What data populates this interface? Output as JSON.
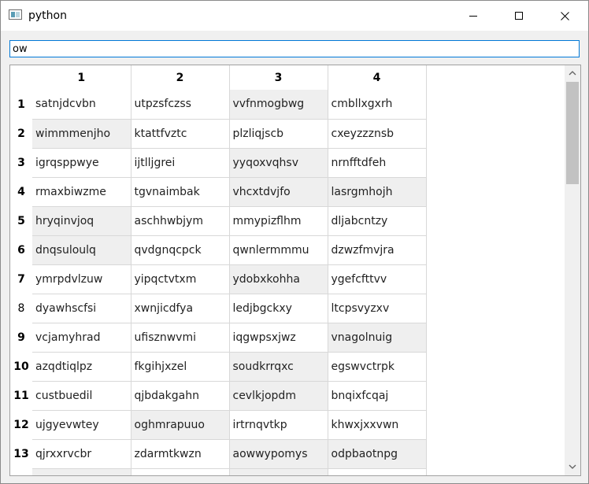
{
  "window": {
    "title": "python"
  },
  "search": {
    "value": "ow"
  },
  "table": {
    "columns": [
      "1",
      "2",
      "3",
      "4"
    ],
    "rows": [
      {
        "label": "1",
        "bold": true,
        "cells": [
          "satnjdcvbn",
          "utpzsfczss",
          "vvfnmogbwg",
          "cmbllxgxrh"
        ],
        "highlight": [
          false,
          false,
          true,
          false
        ]
      },
      {
        "label": "2",
        "bold": true,
        "cells": [
          "wimmmenjho",
          "ktattfvztc",
          "plzliqjscb",
          "cxeyzzznsb"
        ],
        "highlight": [
          true,
          false,
          false,
          false
        ]
      },
      {
        "label": "3",
        "bold": true,
        "cells": [
          "igrqsppwye",
          "ijtlljgrei",
          "yyqoxvqhsv",
          "nrnfftdfeh"
        ],
        "highlight": [
          false,
          false,
          true,
          false
        ]
      },
      {
        "label": "4",
        "bold": true,
        "cells": [
          "rmaxbiwzme",
          "tgvnaimbak",
          "vhcxtdvjfo",
          "lasrgmhojh"
        ],
        "highlight": [
          false,
          false,
          true,
          true
        ]
      },
      {
        "label": "5",
        "bold": true,
        "cells": [
          "hryqinvjoq",
          "aschhwbjym",
          "mmypizflhm",
          "dljabcntzy"
        ],
        "highlight": [
          true,
          false,
          false,
          false
        ]
      },
      {
        "label": "6",
        "bold": true,
        "cells": [
          "dnqsuloulq",
          "qvdgnqcpck",
          "qwnlermmmu",
          "dzwzfmvjra"
        ],
        "highlight": [
          true,
          false,
          false,
          false
        ]
      },
      {
        "label": "7",
        "bold": true,
        "cells": [
          "ymrpdvlzuw",
          "yipqctvtxm",
          "ydobxkohha",
          "ygefcfttvv"
        ],
        "highlight": [
          false,
          false,
          true,
          false
        ]
      },
      {
        "label": "8",
        "bold": false,
        "cells": [
          "dyawhscfsi",
          "xwnjicdfya",
          "ledjbgckxy",
          "ltcpsvyzxv"
        ],
        "highlight": [
          false,
          false,
          false,
          false
        ]
      },
      {
        "label": "9",
        "bold": true,
        "cells": [
          "vcjamyhrad",
          "ufisznwvmi",
          "iqgwpsxjwz",
          "vnagolnuig"
        ],
        "highlight": [
          false,
          false,
          false,
          true
        ]
      },
      {
        "label": "10",
        "bold": true,
        "cells": [
          "azqdtiqlpz",
          "fkgihjxzel",
          "soudkrrqxc",
          "egswvctrpk"
        ],
        "highlight": [
          false,
          false,
          true,
          false
        ]
      },
      {
        "label": "11",
        "bold": true,
        "cells": [
          "custbuedil",
          "qjbdakgahn",
          "cevlkjopdm",
          "bnqixfcqaj"
        ],
        "highlight": [
          false,
          false,
          true,
          false
        ]
      },
      {
        "label": "12",
        "bold": true,
        "cells": [
          "ujgyevwtey",
          "oghmrapuuo",
          "irtrnqvtkp",
          "khwxjxxvwn"
        ],
        "highlight": [
          false,
          true,
          false,
          false
        ]
      },
      {
        "label": "13",
        "bold": true,
        "cells": [
          "qjrxxrvcbr",
          "zdarmtkwzn",
          "aowwypomys",
          "odpbaotnpg"
        ],
        "highlight": [
          false,
          false,
          true,
          true
        ]
      },
      {
        "label": "",
        "bold": true,
        "cells": [
          "",
          "",
          "",
          ""
        ],
        "highlight": [
          true,
          false,
          true,
          false
        ]
      }
    ]
  },
  "icons": {
    "app": "python-app-icon",
    "minimize": "minimize-icon",
    "maximize": "maximize-icon",
    "close": "close-icon",
    "scroll_up": "chevron-up-icon",
    "scroll_down": "chevron-down-icon"
  },
  "scrollbar": {
    "position_fraction": 0.0,
    "visible_fraction": 0.27
  },
  "colors": {
    "focus_border": "#0078d7",
    "highlight_cell": "#efefef",
    "scroll_thumb": "#c2c2c2"
  }
}
